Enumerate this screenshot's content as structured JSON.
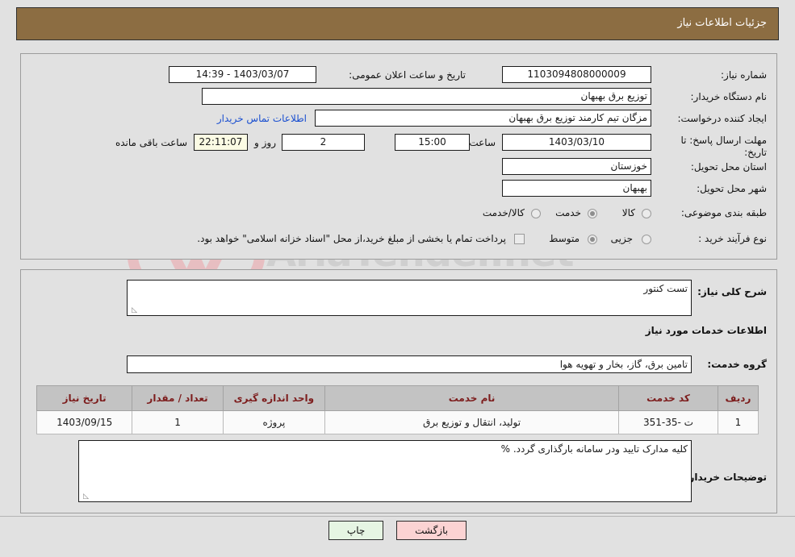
{
  "header": {
    "title": "جزئیات اطلاعات نیاز",
    "bg_color": "#8c6d42",
    "text_color": "#ffffff"
  },
  "form": {
    "need_number_label": "شماره نیاز:",
    "need_number_value": "1103094808000009",
    "announce_datetime_label": "تاریخ و ساعت اعلان عمومی:",
    "announce_datetime_value": "1403/03/07 - 14:39",
    "buyer_org_label": "نام دستگاه خریدار:",
    "buyer_org_value": "توزیع برق بهبهان",
    "requester_label": "ایجاد کننده درخواست:",
    "requester_value": "مزگان تیم کارمند توزیع برق بهبهان",
    "buyer_contact_link": "اطلاعات تماس خریدار",
    "deadline_label": "مهلت ارسال پاسخ: تا تاریخ:",
    "deadline_date_value": "1403/03/10",
    "hour_label": "ساعت",
    "deadline_time_value": "15:00",
    "days_value": "2",
    "days_label": "روز و",
    "countdown_value": "22:11:07",
    "countdown_label": "ساعت باقی مانده",
    "province_label": "استان محل تحویل:",
    "province_value": "خوزستان",
    "city_label": "شهر محل تحویل:",
    "city_value": "بهبهان",
    "classification_label": "طبقه بندی موضوعی:",
    "classification_options": [
      {
        "label": "کالا",
        "selected": false
      },
      {
        "label": "خدمت",
        "selected": true
      },
      {
        "label": "کالا/خدمت",
        "selected": false
      }
    ],
    "purchase_type_label": "نوع فرآیند خرید :",
    "purchase_type_options": [
      {
        "label": "جزیی",
        "selected": false
      },
      {
        "label": "متوسط",
        "selected": true
      }
    ],
    "treasury_checkbox_checked": false,
    "treasury_note": "پرداخت تمام یا بخشی از مبلغ خرید،از محل \"اسناد خزانه اسلامی\" خواهد بود."
  },
  "details": {
    "general_desc_label": "شرح کلی نیاز:",
    "general_desc_value": "تست کنتور",
    "services_section_title": "اطلاعات خدمات مورد نیاز",
    "service_group_label": "گروه خدمت:",
    "service_group_value": "تامین برق، گاز، بخار و تهویه هوا",
    "buyer_notes_label": "توضیحات خریدار:",
    "buyer_notes_value": "کلیه مدارک تایید ودر سامانه بارگذاری گردد. %"
  },
  "table": {
    "headers": [
      "ردیف",
      "کد خدمت",
      "نام خدمت",
      "واحد اندازه گیری",
      "تعداد / مقدار",
      "تاریخ نیاز"
    ],
    "rows": [
      {
        "row_no": "1",
        "service_code": "ت -35-351",
        "service_name": "تولید، انتقال و توزیع برق",
        "unit": "پروژه",
        "quantity": "1",
        "need_date": "1403/09/15"
      }
    ]
  },
  "buttons": {
    "print": "چاپ",
    "back": "بازگشت"
  },
  "watermark": {
    "text": "AriaTender.net",
    "shield_icon": "shield-icon"
  }
}
